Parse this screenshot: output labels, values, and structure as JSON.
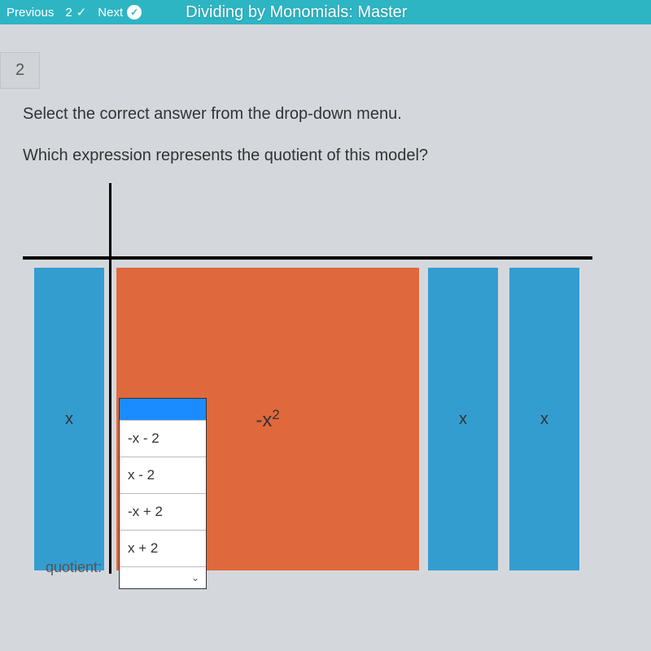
{
  "header": {
    "previous": "Previous",
    "page_num": "2",
    "next": "Next",
    "title": "Dividing by Monomials: Master"
  },
  "question_number": "2",
  "instruction": "Select the correct answer from the drop-down menu.",
  "question": "Which expression represents the quotient of this model?",
  "tiles": {
    "left": "x",
    "square": "-x²",
    "r1": "x",
    "r2": "x"
  },
  "dropdown": {
    "options": [
      "-x - 2",
      "x - 2",
      "-x + 2",
      "x + 2"
    ]
  },
  "quotient_label": "quotient:"
}
